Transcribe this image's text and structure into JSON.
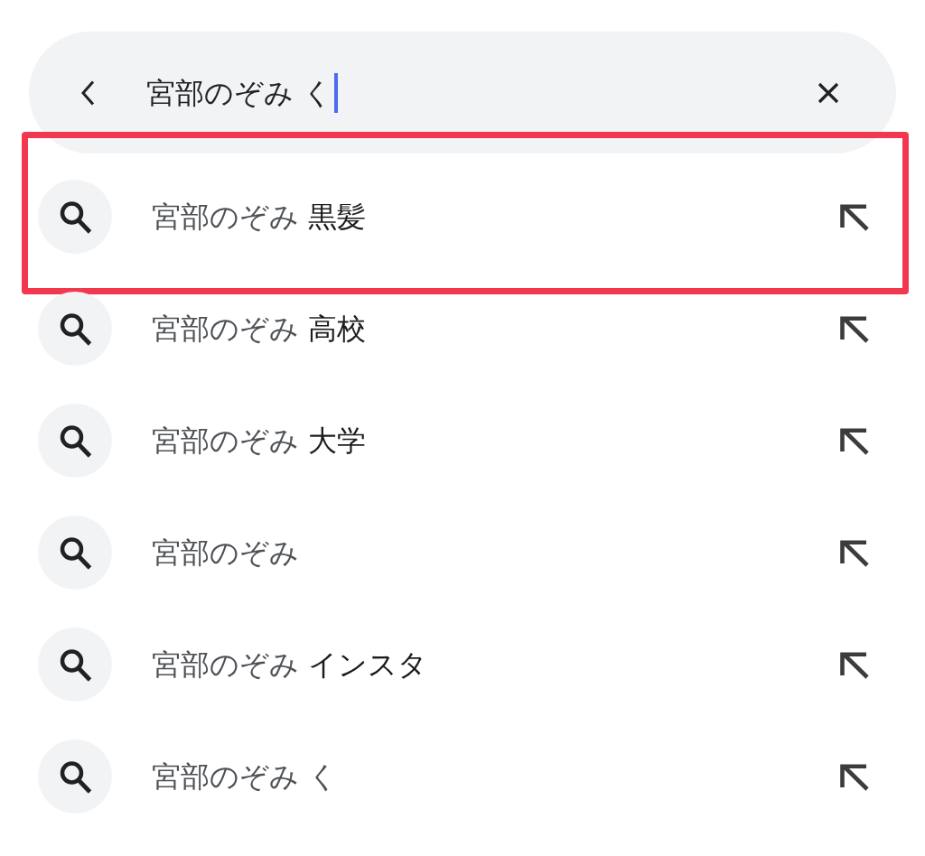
{
  "search_bar": {
    "value": "宮部のぞみ く",
    "focused": true
  },
  "suggestions": [
    {
      "text": "宮部のぞみ **黒髪**",
      "highlighted": true
    },
    {
      "text": "宮部のぞみ **高校**",
      "highlighted": false
    },
    {
      "text": "宮部のぞみ **大学**",
      "highlighted": false
    },
    {
      "text": "宮部のぞみ",
      "highlighted": false
    },
    {
      "text": "宮部のぞみ **インスタ**",
      "highlighted": false
    },
    {
      "text": "宮部のぞみ く",
      "highlighted": false
    }
  ]
}
